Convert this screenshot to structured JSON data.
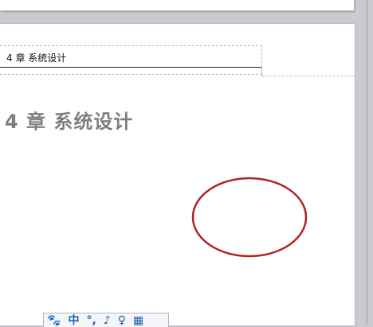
{
  "document": {
    "header_text": "4 章  系统设计",
    "chapter_heading": "4 章  系统设计"
  },
  "annotation": {
    "shape": "ellipse",
    "color": "#b22222"
  },
  "ime_toolbar": {
    "logo_glyph": "🐾",
    "mode_label": "中",
    "punct_glyph": "°,",
    "voice_glyph": "♪",
    "user_glyph": "♀",
    "grid_glyph": "▦"
  }
}
